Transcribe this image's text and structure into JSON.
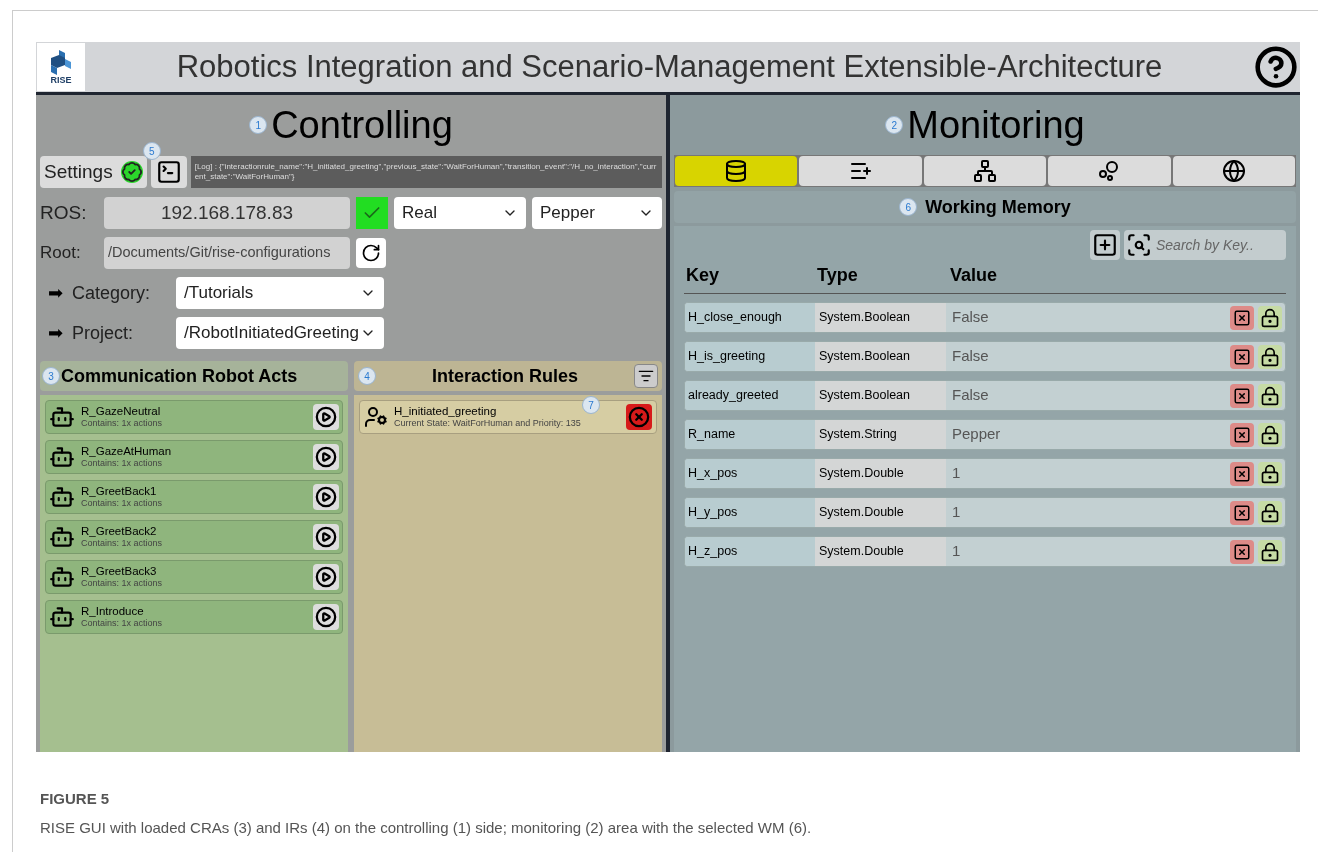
{
  "header": {
    "logo_text": "RISE",
    "title": "Robotics Integration and Scenario-Management Extensible-Architecture"
  },
  "controlling": {
    "badge": "1",
    "title": "Controlling",
    "settings": {
      "label": "Settings",
      "status_ok": true,
      "badge": "5"
    },
    "log": "[Log] : {\"interactionrule_name\":\"H_initiated_greeting\",\"previous_state\":\"WaitForHuman\",\"transition_event\":\"/H_no_interaction\",\"current_state\":\"WaitForHuman\"}",
    "ros": {
      "label": "ROS:",
      "value": "192.168.178.83",
      "connected": true,
      "mode": "Real",
      "robot": "Pepper"
    },
    "root": {
      "label": "Root:",
      "value": "/Documents/Git/rise-configurations"
    },
    "category": {
      "arrow": "➡",
      "label": "Category:",
      "value": "/Tutorials"
    },
    "project": {
      "arrow": "➡",
      "label": "Project:",
      "value": "/RobotInitiatedGreeting"
    },
    "robot_acts": {
      "badge": "3",
      "title": "Communication Robot Acts",
      "items": [
        {
          "name": "R_GazeNeutral",
          "detail": "Contains: 1x actions"
        },
        {
          "name": "R_GazeAtHuman",
          "detail": "Contains: 1x actions"
        },
        {
          "name": "R_GreetBack1",
          "detail": "Contains: 1x actions"
        },
        {
          "name": "R_GreetBack2",
          "detail": "Contains: 1x actions"
        },
        {
          "name": "R_GreetBack3",
          "detail": "Contains: 1x actions"
        },
        {
          "name": "R_Introduce",
          "detail": "Contains: 1x actions"
        }
      ]
    },
    "interaction_rules": {
      "badge": "4",
      "title": "Interaction Rules",
      "items": [
        {
          "name": "H_initiated_greeting",
          "detail": "Current State: WaitForHuman and Priority: 135",
          "badge": "7"
        }
      ]
    }
  },
  "monitoring": {
    "badge": "2",
    "title": "Monitoring",
    "tabs": [
      {
        "kind": "database",
        "selected": true
      },
      {
        "kind": "list",
        "selected": false
      },
      {
        "kind": "tree",
        "selected": false
      },
      {
        "kind": "bubbles",
        "selected": false
      },
      {
        "kind": "globe",
        "selected": false
      }
    ],
    "working_memory": {
      "badge": "6",
      "title": "Working Memory",
      "search": {
        "placeholder": "Search by Key.."
      },
      "columns": [
        "Key",
        "Type",
        "Value"
      ],
      "rows": [
        {
          "key": "H_close_enough",
          "type": "System.Boolean",
          "value": "False"
        },
        {
          "key": "H_is_greeting",
          "type": "System.Boolean",
          "value": "False"
        },
        {
          "key": "already_greeted",
          "type": "System.Boolean",
          "value": "False"
        },
        {
          "key": "R_name",
          "type": "System.String",
          "value": "Pepper"
        },
        {
          "key": "H_x_pos",
          "type": "System.Double",
          "value": "1"
        },
        {
          "key": "H_y_pos",
          "type": "System.Double",
          "value": "1"
        },
        {
          "key": "H_z_pos",
          "type": "System.Double",
          "value": "1"
        }
      ]
    }
  },
  "caption": {
    "label": "FIGURE 5",
    "text": "RISE GUI with loaded CRAs (3) and IRs (4) on the controlling (1) side; monitoring (2) area with the selected WM (6)."
  }
}
